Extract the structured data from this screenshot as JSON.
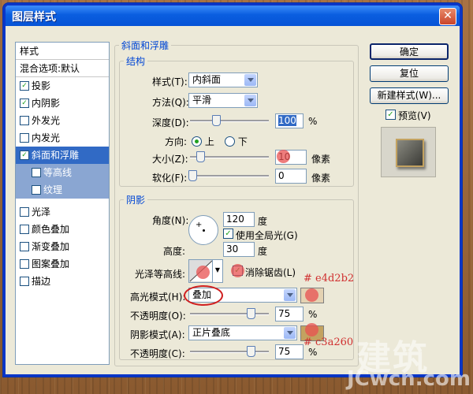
{
  "window": {
    "title": "图层样式",
    "close": "✕"
  },
  "sidebar": {
    "items": [
      {
        "label": "样式",
        "checkbox": false,
        "checked": false
      },
      {
        "label": "混合选项:默认",
        "checkbox": false,
        "checked": false
      },
      {
        "label": "投影",
        "checkbox": true,
        "checked": true
      },
      {
        "label": "内阴影",
        "checkbox": true,
        "checked": true
      },
      {
        "label": "外发光",
        "checkbox": true,
        "checked": false
      },
      {
        "label": "内发光",
        "checkbox": true,
        "checked": false
      },
      {
        "label": "斜面和浮雕",
        "checkbox": true,
        "checked": true
      },
      {
        "label": "等高线",
        "checkbox": true,
        "checked": false
      },
      {
        "label": "纹理",
        "checkbox": true,
        "checked": false
      },
      {
        "label": "光泽",
        "checkbox": true,
        "checked": false
      },
      {
        "label": "颜色叠加",
        "checkbox": true,
        "checked": false
      },
      {
        "label": "渐变叠加",
        "checkbox": true,
        "checked": false
      },
      {
        "label": "图案叠加",
        "checkbox": true,
        "checked": false
      },
      {
        "label": "描边",
        "checkbox": true,
        "checked": false
      }
    ]
  },
  "bevel": {
    "group_title": "斜面和浮雕",
    "structure": {
      "title": "结构",
      "style_label": "样式(T):",
      "style_value": "内斜面",
      "technique_label": "方法(Q):",
      "technique_value": "平滑",
      "depth_label": "深度(D):",
      "depth_value": "100",
      "depth_unit": "%",
      "direction_label": "方向:",
      "direction_up": "上",
      "direction_down": "下",
      "size_label": "大小(Z):",
      "size_value": "10",
      "size_unit": "像素",
      "soften_label": "软化(F):",
      "soften_value": "0",
      "soften_unit": "像素"
    },
    "shading": {
      "title": "阴影",
      "angle_label": "角度(N):",
      "angle_value": "120",
      "angle_unit": "度",
      "global_light_label": "使用全局光(G)",
      "altitude_label": "高度:",
      "altitude_value": "30",
      "altitude_unit": "度",
      "gloss_label": "光泽等高线:",
      "antialias_label": "消除锯齿(L)",
      "highlight_mode_label": "高光模式(H):",
      "highlight_mode_value": "叠加",
      "highlight_opacity_label": "不透明度(O):",
      "highlight_opacity_value": "75",
      "highlight_opacity_unit": "%",
      "highlight_color": "#e4d2b2",
      "shadow_mode_label": "阴影模式(A):",
      "shadow_mode_value": "正片叠底",
      "shadow_opacity_label": "不透明度(C):",
      "shadow_opacity_value": "75",
      "shadow_opacity_unit": "%",
      "shadow_color": "#c3a260"
    }
  },
  "annotations": {
    "highlight_hex": "# e4d2b2",
    "shadow_hex": "# c3a260"
  },
  "buttons": {
    "ok": "确定",
    "reset": "复位",
    "new_style": "新建样式(W)...",
    "preview": "预览(V)"
  },
  "watermark": {
    "brand": "建筑",
    "url": "JCwcn.com"
  }
}
